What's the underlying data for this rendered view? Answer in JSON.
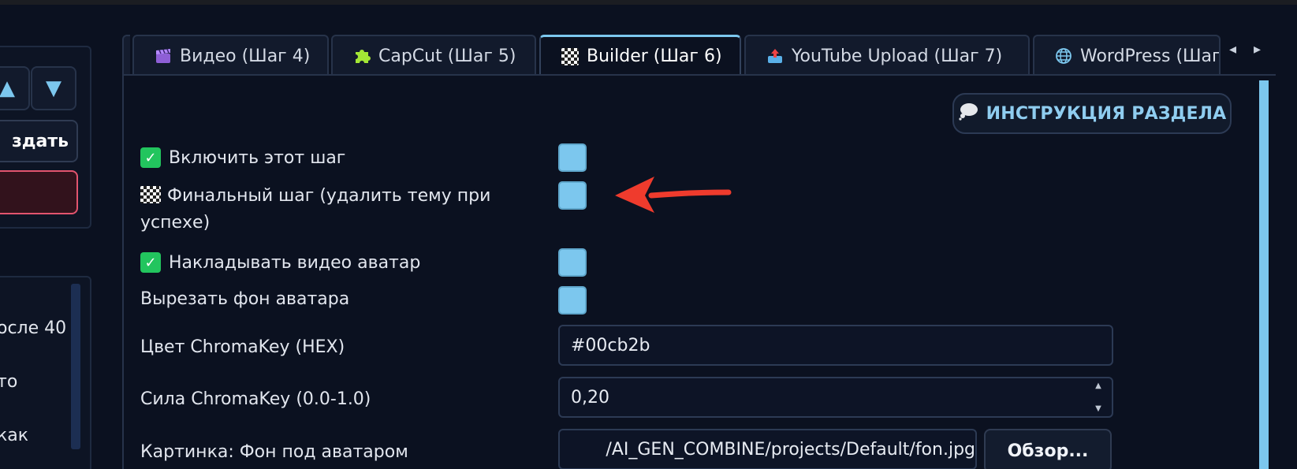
{
  "left_panel": {
    "up_arrow": "▲",
    "down_arrow": "▼",
    "create_label": "здать",
    "list_items": [
      "осле 40",
      "то",
      "как"
    ]
  },
  "tabs": [
    {
      "label": "Видео (Шаг 4)",
      "icon": "clapperboard-icon"
    },
    {
      "label": "CapCut (Шаг 5)",
      "icon": "puzzle-icon"
    },
    {
      "label": "Builder (Шаг 6)",
      "icon": "checkered-flag-icon",
      "active": true
    },
    {
      "label": "YouTube Upload (Шаг 7)",
      "icon": "outbox-tray-icon"
    },
    {
      "label": "WordPress (Шаг",
      "icon": "globe-icon"
    }
  ],
  "tab_nav": {
    "prev": "◂",
    "next": "▸"
  },
  "instruction_button": {
    "label": "ИНСТРУКЦИЯ РАЗДЕЛА",
    "icon": "thought-balloon-icon"
  },
  "settings": {
    "enable_step": {
      "label": "Включить этот шаг",
      "checked": false
    },
    "final_step": {
      "label_line1": "Финальный шаг (удалить тему при",
      "label_line2": "успехе)",
      "checked": false
    },
    "overlay_avatar": {
      "label": "Накладывать видео аватар",
      "checked": false
    },
    "cut_background": {
      "label": "Вырезать фон аватара",
      "checked": false
    },
    "chromakey_color": {
      "label": "Цвет ChromaKey (HEX)",
      "value": "#00cb2b"
    },
    "chromakey_strength": {
      "label": "Сила ChromaKey (0.0-1.0)",
      "value": "0,20"
    },
    "background_image": {
      "label": "Картинка: Фон под аватаром",
      "value": "/AI_GEN_COMBINE/projects/Default/fon.jpg",
      "browse_label": "Обзор..."
    }
  },
  "colors": {
    "accent": "#7cc7ee",
    "arrow": "#ef3b2d",
    "check_green": "#22c55e"
  }
}
